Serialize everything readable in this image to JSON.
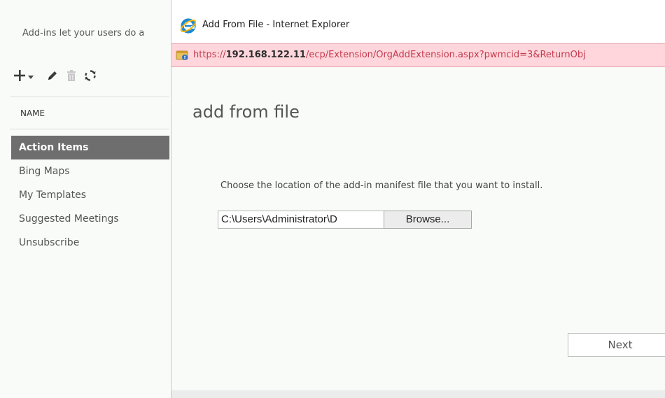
{
  "ecp": {
    "intro_text": "Add-ins let your users do a",
    "list_header": "NAME",
    "items": [
      {
        "label": "Action Items",
        "selected": true
      },
      {
        "label": "Bing Maps",
        "selected": false
      },
      {
        "label": "My Templates",
        "selected": false
      },
      {
        "label": "Suggested Meetings",
        "selected": false
      },
      {
        "label": "Unsubscribe",
        "selected": false
      }
    ],
    "toolbar_icons": [
      "add-icon",
      "edit-icon",
      "delete-icon",
      "refresh-icon"
    ]
  },
  "ie_window": {
    "title": "Add From File - Internet Explorer",
    "url_prefix": "https://",
    "url_host": "192.168.122.11",
    "url_path": "/ecp/Extension/OrgAddExtension.aspx?pwmcid=3&ReturnObj",
    "addressbar_color": "#ffd6dc"
  },
  "dialog": {
    "heading": "add from file",
    "instruction": "Choose the location of the add-in manifest file that you want to install.",
    "file_path_value": "C:\\Users\\Administrator\\D",
    "browse_label": "Browse...",
    "next_label": "Next"
  }
}
